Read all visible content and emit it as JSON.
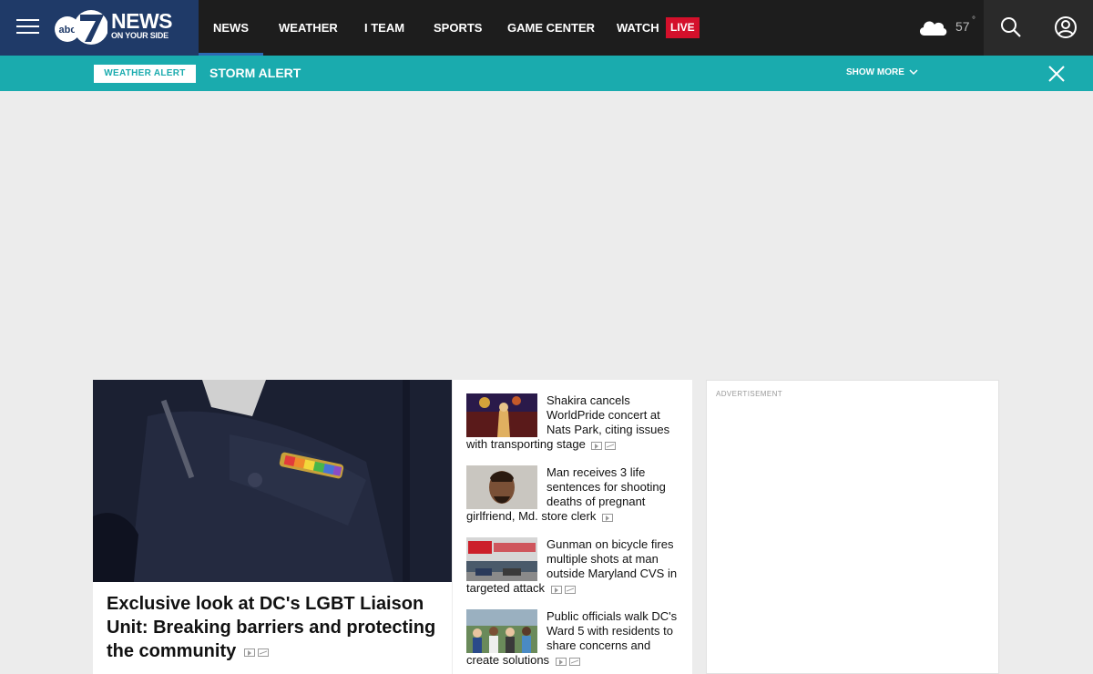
{
  "brand": {
    "logo_text": "NEWS",
    "logo_sub": "ON YOUR SIDE",
    "logo_badge": "abc7"
  },
  "nav": {
    "items": [
      {
        "label": "NEWS"
      },
      {
        "label": "WEATHER"
      },
      {
        "label": "I TEAM"
      },
      {
        "label": "SPORTS"
      },
      {
        "label": "GAME CENTER"
      },
      {
        "label": "WATCH"
      }
    ],
    "live_label": "LIVE",
    "temperature": "57",
    "degree": "°"
  },
  "alert": {
    "tag": "WEATHER ALERT",
    "title": "STORM ALERT",
    "show_more": "SHOW MORE"
  },
  "hero": {
    "title": "Exclusive look at DC's LGBT Liaison Unit: Breaking barriers and protecting the community"
  },
  "stories": [
    {
      "title": "Shakira cancels WorldPride concert at Nats Park, citing issues with transporting stage",
      "icons": [
        "video",
        "photo"
      ]
    },
    {
      "title": "Man receives 3 life sentences for shooting deaths of pregnant girlfriend, Md. store clerk",
      "icons": [
        "video"
      ]
    },
    {
      "title": "Gunman on bicycle fires multiple shots at man outside Maryland CVS in targeted attack",
      "icons": [
        "video",
        "photo"
      ]
    },
    {
      "title": "Public officials walk DC's Ward 5 with residents to share concerns and create solutions",
      "icons": [
        "video",
        "photo"
      ]
    }
  ],
  "ad": {
    "label": "ADVERTISEMENT"
  },
  "colors": {
    "brand_blue": "#1f3a68",
    "alert_teal": "#1aabae",
    "live_red": "#d4102b",
    "nav_dark": "#1d1d1d"
  }
}
